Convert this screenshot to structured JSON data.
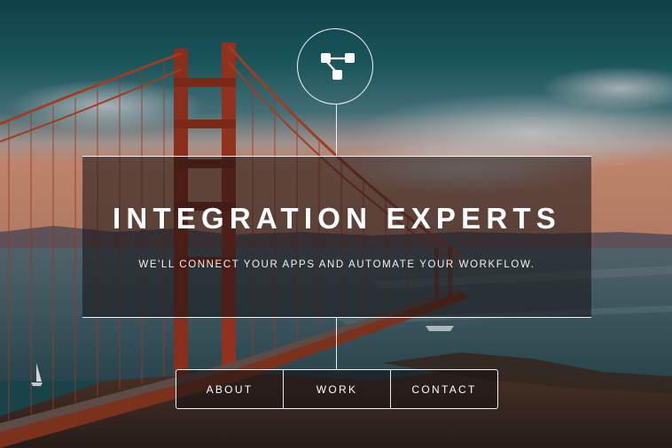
{
  "logo": {
    "icon": "workflow-nodes-icon"
  },
  "hero": {
    "title": "INTEGRATION EXPERTS",
    "subtitle": "WE'LL CONNECT YOUR APPS AND AUTOMATE YOUR WORKFLOW."
  },
  "nav": {
    "items": [
      {
        "label": "ABOUT"
      },
      {
        "label": "WORK"
      },
      {
        "label": "CONTACT"
      }
    ]
  },
  "background": {
    "subject": "suspension bridge over bay at sunset",
    "colors": {
      "sky_top": "#1c5a63",
      "sky_low": "#c98a6a",
      "bridge": "#a23a22",
      "water": "#3f5660",
      "foreground": "#3a2b24"
    }
  }
}
